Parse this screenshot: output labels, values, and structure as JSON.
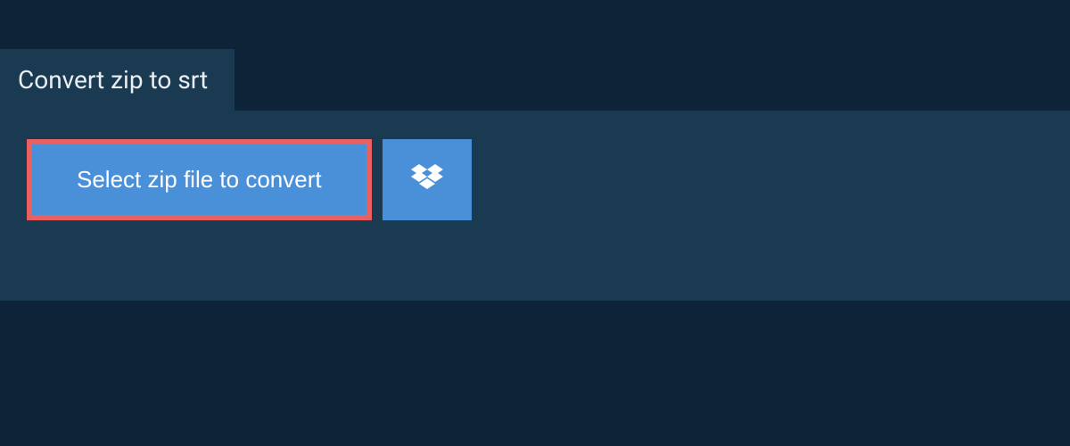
{
  "header": {
    "title": "Convert zip to srt"
  },
  "actions": {
    "select_file_label": "Select zip file to convert",
    "dropbox_name": "dropbox"
  },
  "colors": {
    "background": "#0d2438",
    "panel": "#1a3a52",
    "button": "#4a90d9",
    "highlight_border": "#e86060",
    "text_light": "#e8eef3",
    "text_white": "#ffffff"
  }
}
